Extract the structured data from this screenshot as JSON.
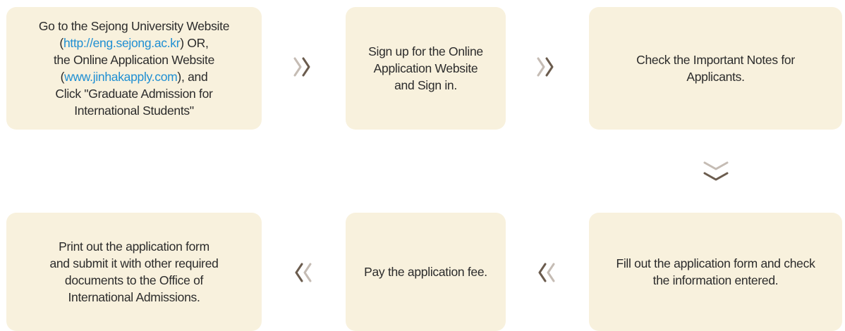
{
  "steps": {
    "step1": {
      "l1": "Go to the Sejong University Website",
      "l2_open": "(",
      "l2_link": "http://eng.sejong.ac.kr",
      "l2_close": ") OR,",
      "l3": "the Online Application Website",
      "l4_open": "(",
      "l4_link": "www.jinhakapply.com",
      "l4_close": "), and",
      "l5": "Click \"Graduate Admission for",
      "l6": "International Students\""
    },
    "step2": {
      "l1": "Sign up for the Online",
      "l2": "Application Website",
      "l3": "and Sign in."
    },
    "step3": {
      "l1": "Check the Important Notes for",
      "l2": "Applicants."
    },
    "step4": {
      "l1": "Print out the application form",
      "l2": "and submit it with other required",
      "l3": "documents to the Office of",
      "l4": "International Admissions."
    },
    "step5": {
      "l1": "Pay the application fee."
    },
    "step6": {
      "l1": "Fill out the application form and check",
      "l2": "the information entered."
    }
  },
  "colors": {
    "box_bg": "#f8f1dd",
    "link": "#1f8fd3",
    "arrow_light": "#c5bcb4",
    "arrow_dark": "#6b5c4e",
    "text": "#2b2b2b"
  },
  "icons": {
    "right": "double-chevron-right-icon",
    "down": "double-chevron-down-icon",
    "left": "double-chevron-left-icon"
  }
}
